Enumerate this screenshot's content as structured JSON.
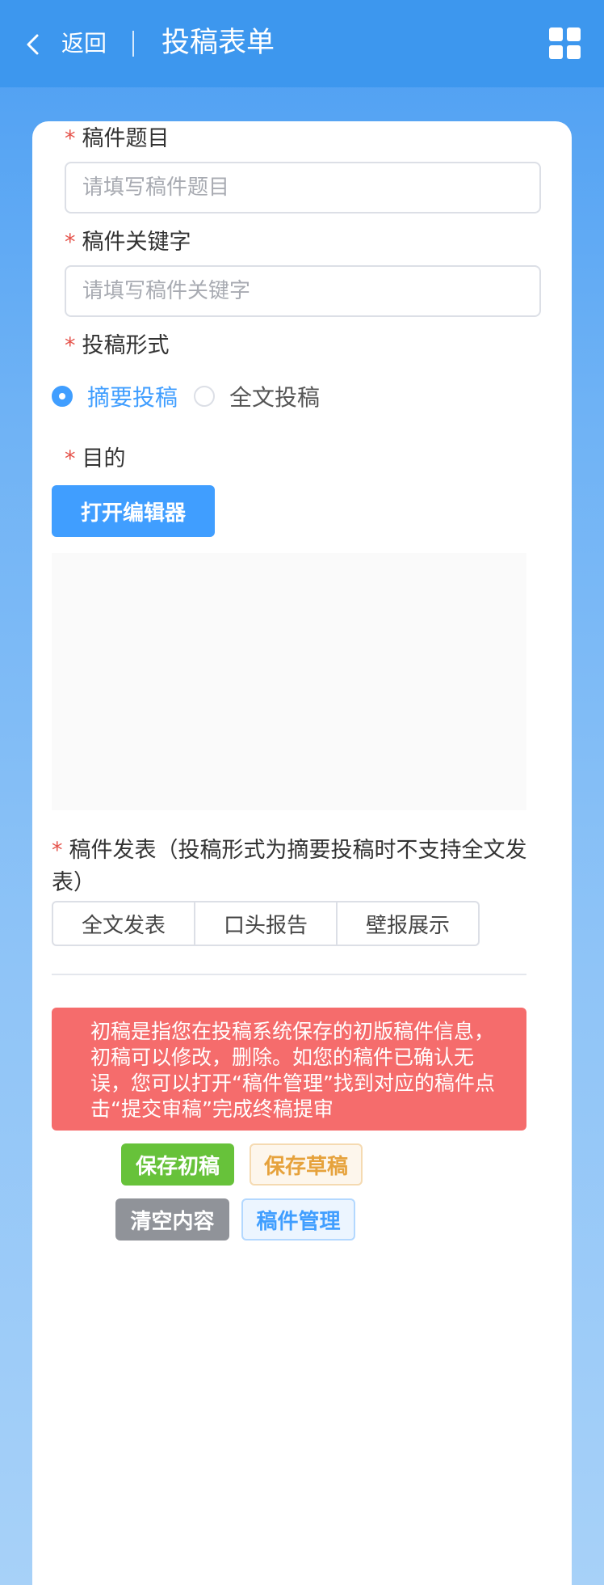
{
  "header": {
    "back_label": "返回",
    "title": "投稿表单",
    "back_icon": "chevron-left-icon",
    "menu_icon": "grid-icon"
  },
  "form": {
    "title_field": {
      "label": "稿件题目",
      "placeholder": "请填写稿件题目",
      "value": ""
    },
    "keywords_field": {
      "label": "稿件关键字",
      "placeholder": "请填写稿件关键字",
      "value": ""
    },
    "submission_type": {
      "label": "投稿形式",
      "options": [
        "摘要投稿",
        "全文投稿"
      ],
      "selected": "摘要投稿"
    },
    "purpose": {
      "label": "目的",
      "editor_button": "打开编辑器"
    },
    "publication": {
      "label": "稿件发表（投稿形式为摘要投稿时不支持全文发表）",
      "options": [
        "全文发表",
        "口头报告",
        "壁报展示"
      ]
    }
  },
  "notice": "初稿是指您在投稿系统保存的初版稿件信息，初稿可以修改，删除。如您的稿件已确认无误，您可以打开“稿件管理”找到对应的稿件点击“提交审稿”完成终稿提审",
  "actions": {
    "save_first": "保存初稿",
    "save_draft": "保存草稿",
    "clear": "清空内容",
    "manage": "稿件管理"
  },
  "required_mark": "*",
  "colors": {
    "header": "#3d97ee",
    "primary": "#409eff",
    "success": "#67c23a",
    "warning": "#e6a23c",
    "danger": "#f56c6c",
    "info": "#909399"
  }
}
